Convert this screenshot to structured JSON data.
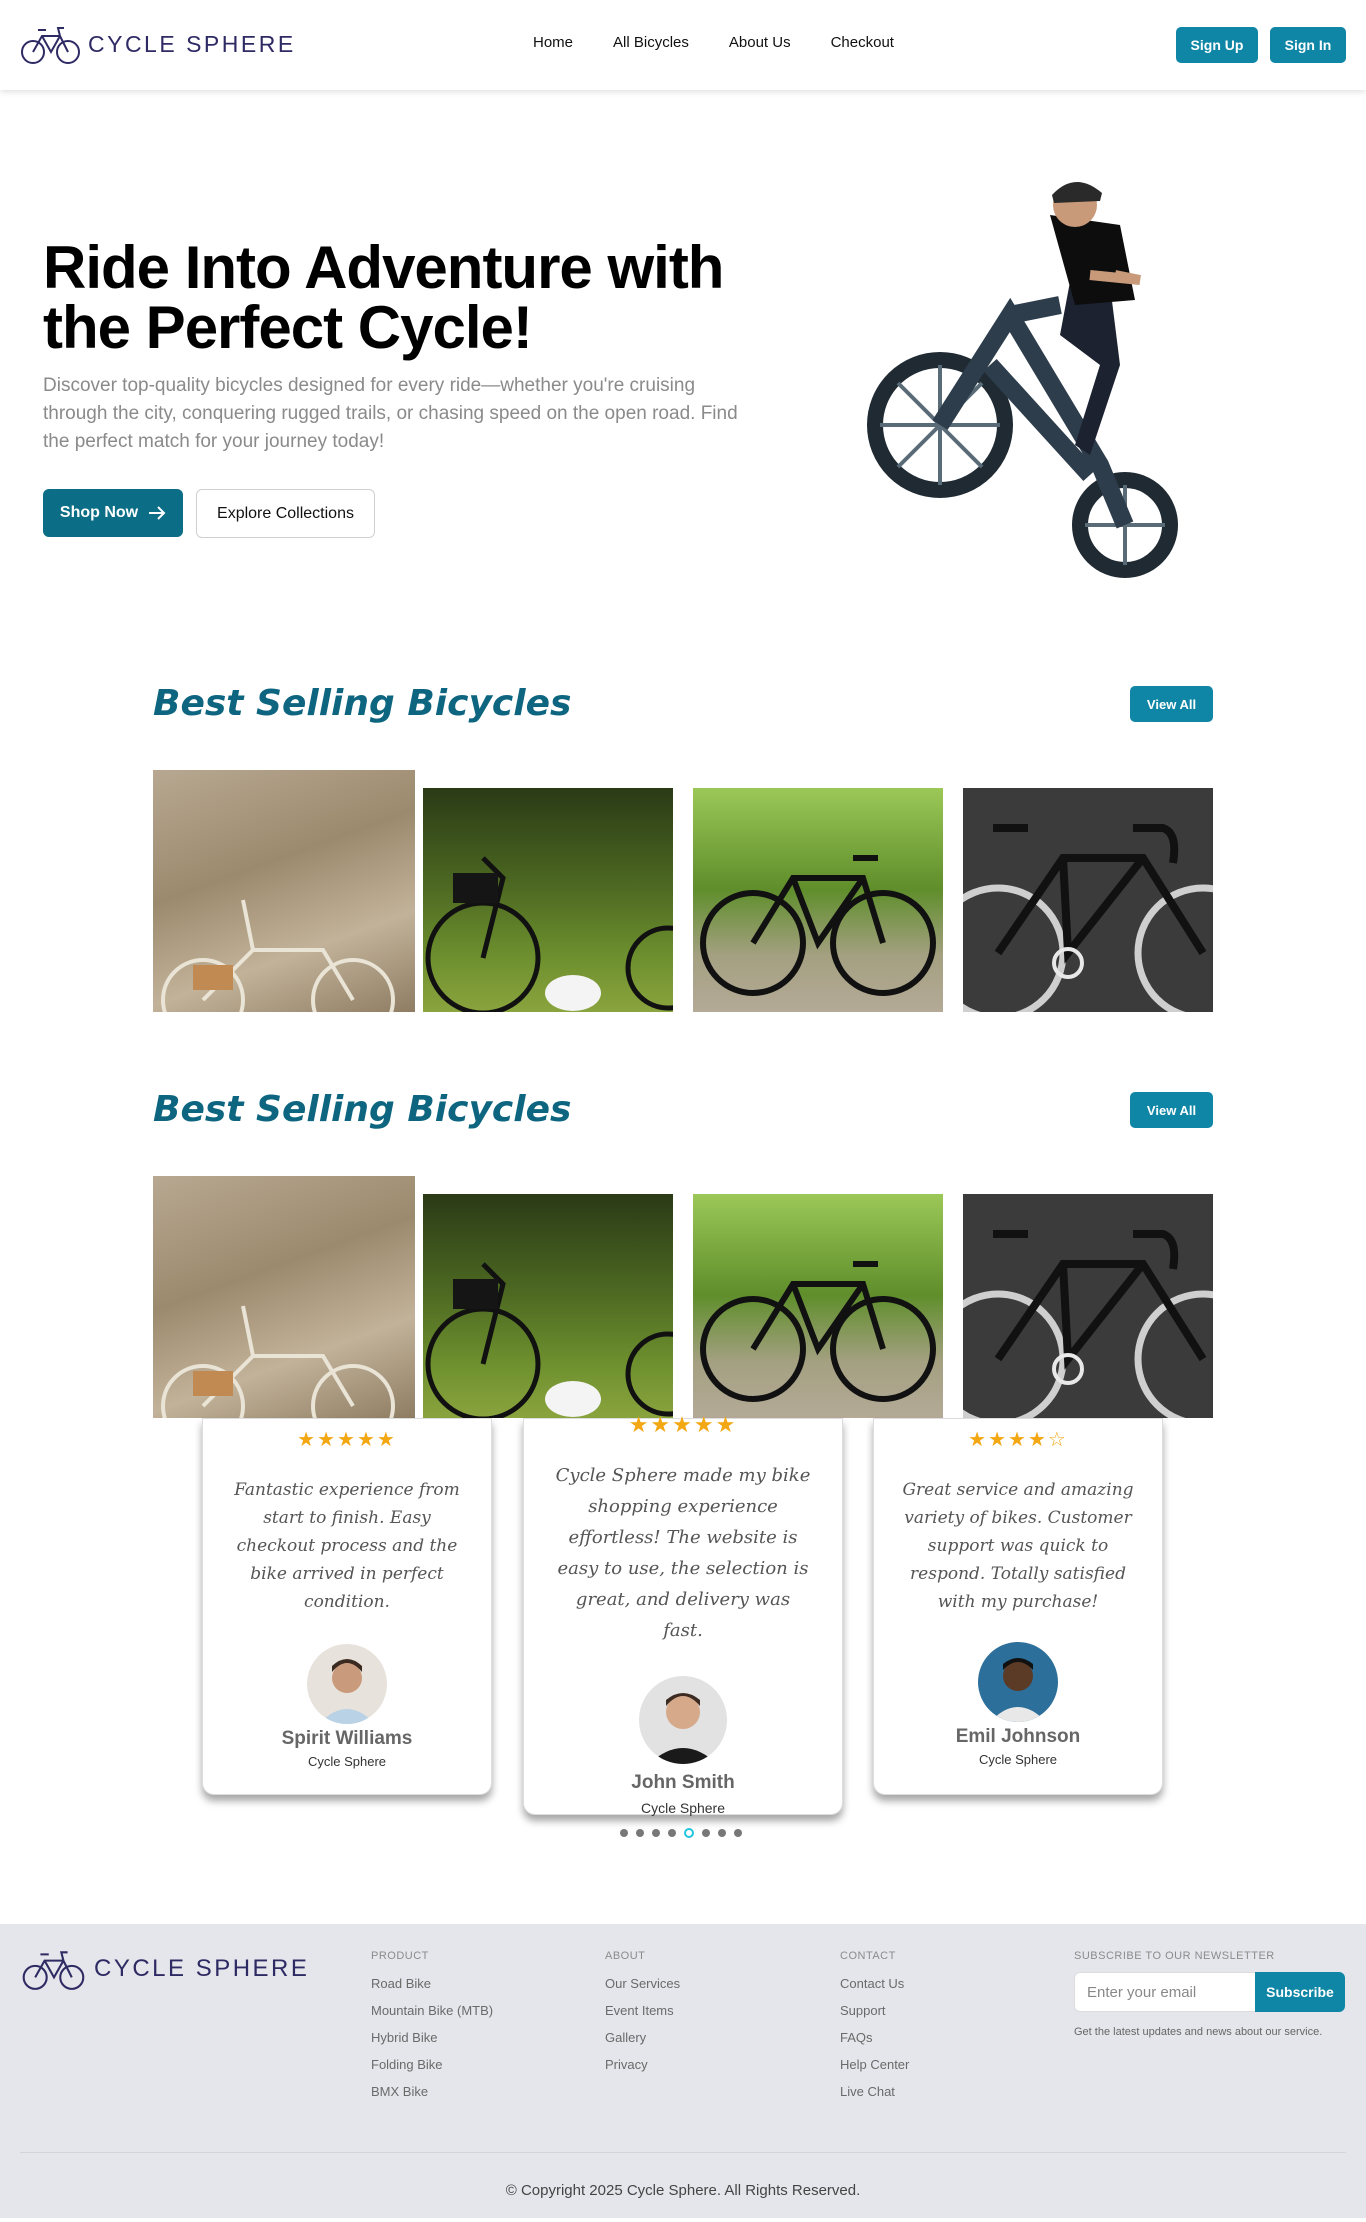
{
  "brand": {
    "name": "CYCLE SPHERE",
    "logo": "bicycle-logo-icon"
  },
  "nav": {
    "links": [
      "Home",
      "All Bicycles",
      "About Us",
      "Checkout"
    ],
    "signup": "Sign Up",
    "signin": "Sign In"
  },
  "hero": {
    "title": "Ride Into Adventure with the Perfect Cycle!",
    "description": "Discover top-quality bicycles designed for every ride—whether you're cruising through the city, conquering rugged trails, or chasing speed on the open road. Find the perfect match for your journey today!",
    "shop_label": "Shop Now",
    "shop_icon": "arrow-right-icon",
    "explore_label": "Explore Collections"
  },
  "sections": [
    {
      "title": "Best Selling Bicycles",
      "view_all": "View All"
    },
    {
      "title": "Best Selling Bicycles",
      "view_all": "View All"
    }
  ],
  "testimonials": [
    {
      "stars": "★★★★★",
      "quote": "Fantastic experience from start to finish. Easy checkout process and the bike arrived in perfect condition.",
      "name": "Spirit Williams",
      "company": "Cycle Sphere"
    },
    {
      "stars": "★★★★★",
      "quote": "Cycle Sphere made my bike shopping experience effortless! The website is easy to use, the selection is great, and delivery was fast.",
      "name": "John Smith",
      "company": "Cycle Sphere"
    },
    {
      "stars": "★★★★☆",
      "quote": "Great service and amazing variety of bikes. Customer support was quick to respond. Totally satisfied with my purchase!",
      "name": "Emil Johnson",
      "company": "Cycle Sphere"
    }
  ],
  "carousel": {
    "count": 8,
    "active": 4
  },
  "footer": {
    "product": {
      "heading": "PRODUCT",
      "links": [
        "Road Bike",
        "Mountain Bike (MTB)",
        "Hybrid Bike",
        "Folding Bike",
        "BMX Bike"
      ]
    },
    "about": {
      "heading": "ABOUT",
      "links": [
        "Our Services",
        "Event Items",
        "Gallery",
        "Privacy"
      ]
    },
    "contact": {
      "heading": "CONTACT",
      "links": [
        "Contact Us",
        "Support",
        "FAQs",
        "Help Center",
        "Live Chat"
      ]
    },
    "newsletter": {
      "heading": "SUBSCRIBE TO OUR NEWSLETTER",
      "placeholder": "Enter your email",
      "button": "Subscribe",
      "note": "Get the latest updates and news about our service."
    },
    "copyright": "© Copyright 2025 Cycle Sphere. All Rights Reserved."
  },
  "colors": {
    "accent": "#0f86a6",
    "dark_accent": "#0b6e86",
    "section_title": "#0e6580",
    "stars": "#f3a712"
  }
}
